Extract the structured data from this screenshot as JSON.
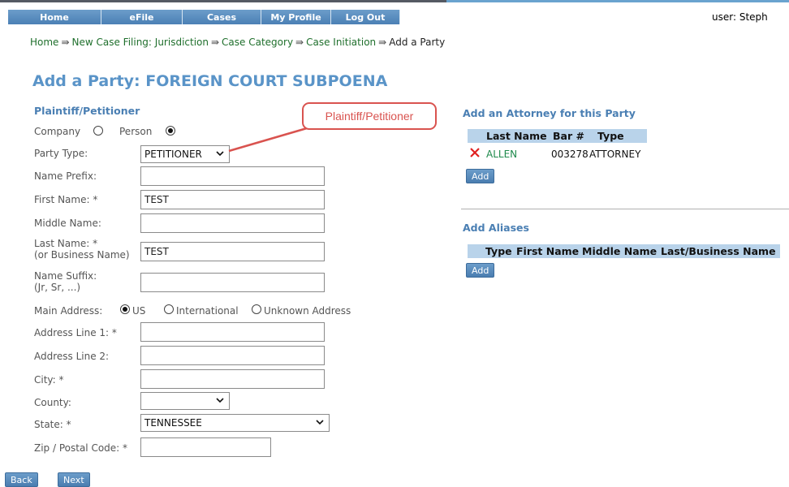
{
  "nav": {
    "items": [
      {
        "label": "Home"
      },
      {
        "label": "eFile"
      },
      {
        "label": "Cases"
      },
      {
        "label": "My Profile"
      },
      {
        "label": "Log Out"
      }
    ],
    "user_label": "user: Steph"
  },
  "breadcrumb": {
    "items": [
      "Home",
      "New Case Filing: Jurisdiction",
      "Case Category",
      "Case Initiation"
    ],
    "current": "Add a Party",
    "separator": "⇛"
  },
  "page_title": "Add a Party: FOREIGN COURT SUBPOENA",
  "form": {
    "section_title": "Plaintiff/Petitioner",
    "entity": {
      "company_label": "Company",
      "person_label": "Person",
      "selected": "Person"
    },
    "party_type": {
      "label": "Party Type:",
      "value": "PETITIONER"
    },
    "name_prefix": {
      "label": "Name Prefix:",
      "value": ""
    },
    "first_name": {
      "label": "First Name: *",
      "value": "TEST"
    },
    "middle_name": {
      "label": "Middle Name:",
      "value": ""
    },
    "last_name": {
      "label_line1": "Last Name: *",
      "label_line2": "(or Business Name)",
      "value": "TEST"
    },
    "name_suffix": {
      "label_line1": "Name Suffix:",
      "label_line2": "(Jr, Sr, ...)",
      "value": ""
    },
    "main_address": {
      "label": "Main Address:",
      "options": [
        "US",
        "International",
        "Unknown Address"
      ],
      "selected": "US"
    },
    "address_line1": {
      "label": "Address Line 1: *",
      "value": ""
    },
    "address_line2": {
      "label": "Address Line 2:",
      "value": ""
    },
    "city": {
      "label": "City: *",
      "value": ""
    },
    "county": {
      "label": "County:",
      "value": ""
    },
    "state": {
      "label": "State: *",
      "value": "TENNESSEE"
    },
    "zip": {
      "label": "Zip / Postal Code: *",
      "value": ""
    }
  },
  "callout": {
    "text": "Plaintiff/Petitioner",
    "color": "#d9534f"
  },
  "attorneys": {
    "title": "Add an Attorney for this Party",
    "columns": [
      "Last Name",
      "Bar #",
      "Type"
    ],
    "rows": [
      {
        "last_name": "ALLEN",
        "bar": "003278",
        "type": "ATTORNEY"
      }
    ],
    "add_label": "Add"
  },
  "aliases": {
    "title": "Add Aliases",
    "columns": [
      "Type",
      "First Name",
      "Middle Name",
      "Last/Business Name"
    ],
    "add_label": "Add"
  },
  "footer": {
    "back_label": "Back",
    "next_label": "Next"
  },
  "colors": {
    "nav_blue": "#5a8ec2",
    "title_blue": "#5a94c8",
    "link_green": "#1f6f2c",
    "header_blue": "#b9d3ea",
    "delete_red": "#e02020"
  }
}
